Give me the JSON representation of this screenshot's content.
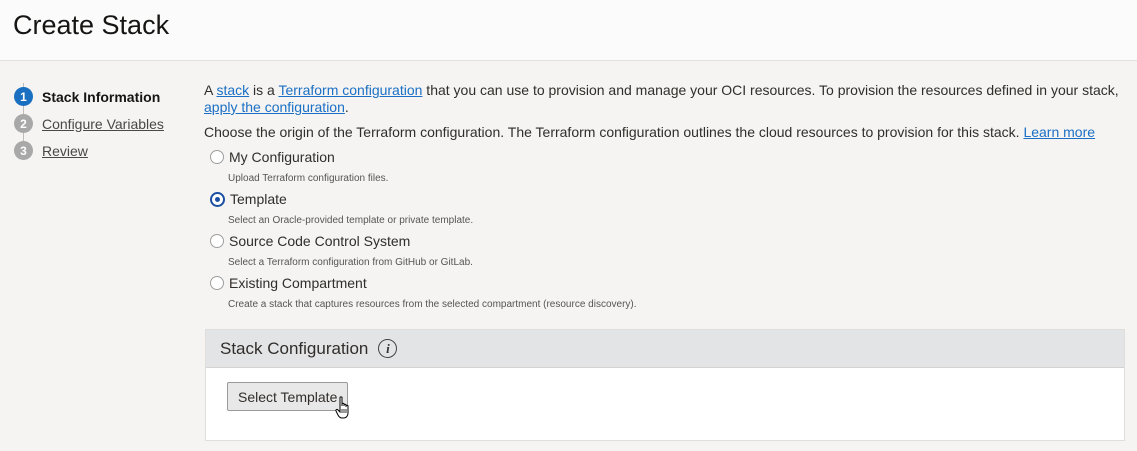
{
  "header": {
    "title": "Create Stack"
  },
  "steps": [
    {
      "number": "1",
      "label": "Stack Information"
    },
    {
      "number": "2",
      "label": "Configure Variables"
    },
    {
      "number": "3",
      "label": "Review"
    }
  ],
  "intro": {
    "p1_a": "A ",
    "stack_link": "stack",
    "p1_b": " is a ",
    "terraform_link": "Terraform configuration",
    "p1_c": " that you can use to provision and manage your OCI resources. To provision the resources defined in your stack, ",
    "apply_link": "apply the configuration",
    "p1_d": "."
  },
  "choose": {
    "text": "Choose the origin of the Terraform configuration. The Terraform configuration outlines the cloud resources to provision for this stack. ",
    "learn_more": "Learn more"
  },
  "options": [
    {
      "label": "My Configuration",
      "desc": "Upload Terraform configuration files."
    },
    {
      "label": "Template",
      "desc": "Select an Oracle-provided template or private template."
    },
    {
      "label": "Source Code Control System",
      "desc": "Select a Terraform configuration from GitHub or GitLab."
    },
    {
      "label": "Existing Compartment",
      "desc": "Create a stack that captures resources from the selected compartment (resource discovery)."
    }
  ],
  "panel": {
    "title": "Stack Configuration",
    "info_glyph": "i",
    "button": "Select Template"
  }
}
